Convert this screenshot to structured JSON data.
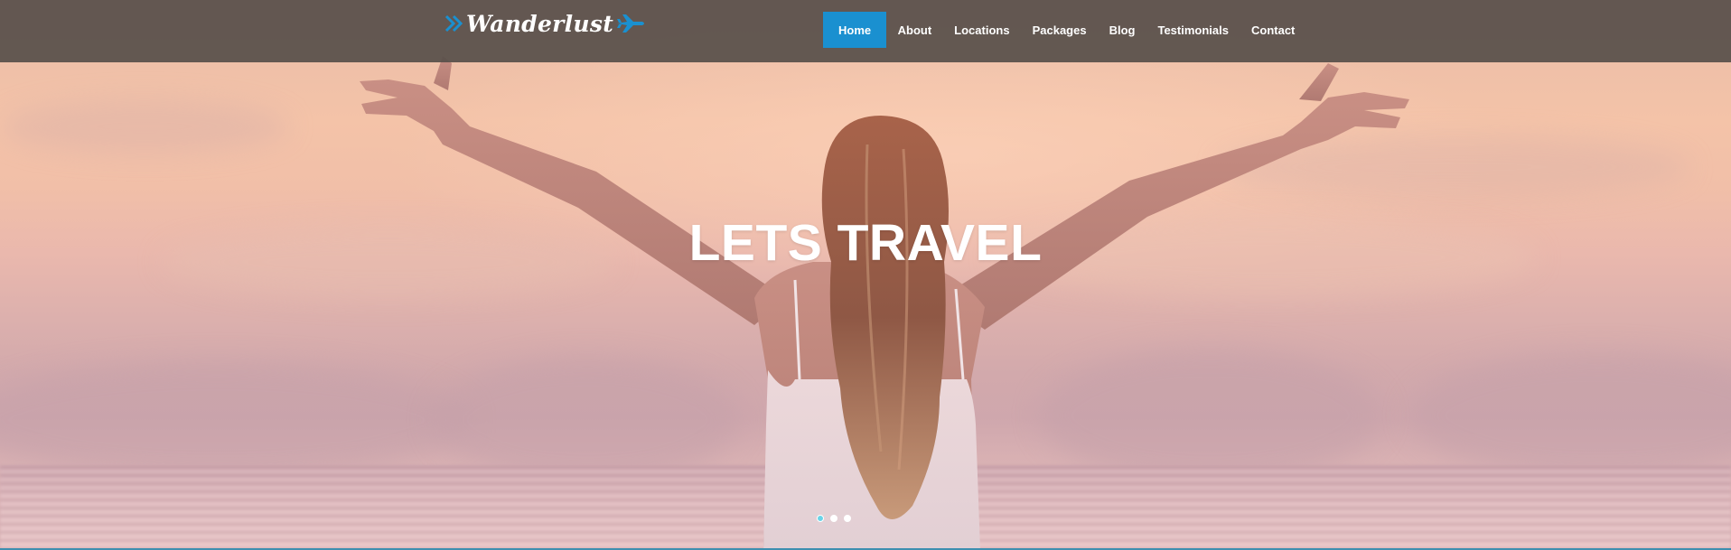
{
  "brand": {
    "name": "Wanderlust",
    "accent_color": "#1a90d0",
    "icons": [
      "double-chevron-right-icon",
      "airplane-icon"
    ]
  },
  "nav": {
    "items": [
      {
        "label": "Home",
        "active": true
      },
      {
        "label": "About",
        "active": false
      },
      {
        "label": "Locations",
        "active": false
      },
      {
        "label": "Packages",
        "active": false
      },
      {
        "label": "Blog",
        "active": false
      },
      {
        "label": "Testimonials",
        "active": false
      },
      {
        "label": "Contact",
        "active": false
      }
    ]
  },
  "hero": {
    "title": "LETS TRAVEL",
    "image": "woman-arms-outstretched-sunset-beach",
    "slides_count": 3,
    "active_slide": 1
  }
}
